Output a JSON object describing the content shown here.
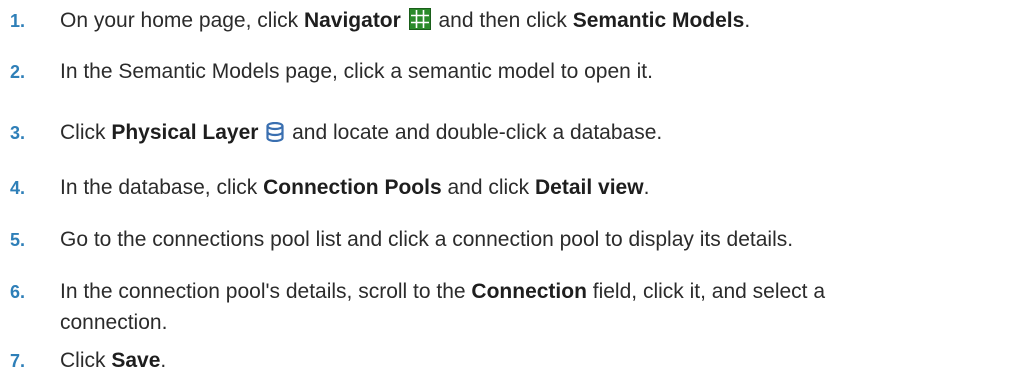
{
  "steps": [
    {
      "number": "1.",
      "parts": [
        "On your home page, click ",
        "Navigator",
        "and then click ",
        "Semantic Models",
        "."
      ],
      "icon": "navigator-grid-icon",
      "icon_color": "#2a8a2a"
    },
    {
      "number": "2.",
      "text": "In the Semantic Models page, click a semantic model to open it."
    },
    {
      "number": "3.",
      "parts": [
        "Click ",
        "Physical Layer",
        "and locate and double-click a database."
      ],
      "icon": "physical-layer-database-icon",
      "icon_color": "#3a6fb0"
    },
    {
      "number": "4.",
      "parts": [
        "In the database, click ",
        "Connection Pools",
        " and click ",
        "Detail view",
        "."
      ]
    },
    {
      "number": "5.",
      "text": "Go to the connections pool list and click a connection pool to display its details."
    },
    {
      "number": "6.",
      "parts": [
        "In the connection pool's details, scroll to the ",
        "Connection",
        " field, click it, and select a"
      ],
      "continuation": "connection."
    },
    {
      "number": "7.",
      "parts": [
        "Click ",
        "Save",
        "."
      ]
    }
  ]
}
